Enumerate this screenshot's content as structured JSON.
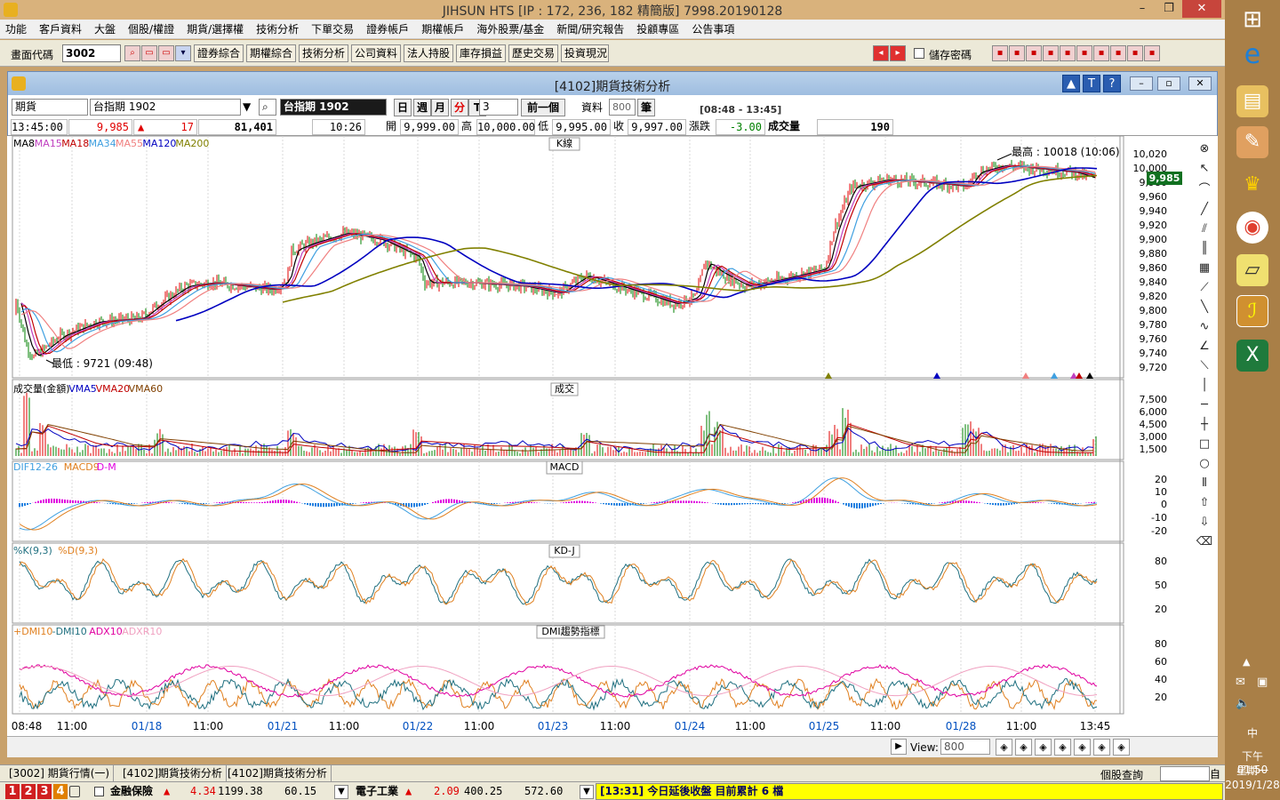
{
  "window": {
    "title": "JIHSUN HTS    [IP : 172, 236, 182 精簡版] 7998.20190128",
    "min": "–",
    "max": "❐",
    "close": "✕"
  },
  "menu": [
    "功能",
    "客戶資料",
    "大盤",
    "個股/權證",
    "期貨/選擇權",
    "技術分析",
    "下單交易",
    "證券帳戶",
    "期權帳戶",
    "海外股票/基金",
    "新聞/研究報告",
    "投顧專區",
    "公告事項"
  ],
  "toolbar": {
    "code_label": "畫面代碼",
    "code_value": "3002",
    "buttons": [
      "證券綜合",
      "期權綜合",
      "技術分析",
      "公司資料",
      "法人持股",
      "庫存損益",
      "歷史交易",
      "投資現況"
    ],
    "save_pwd_label": "儲存密碼"
  },
  "inner": {
    "title": "[4102]期貨技術分析",
    "type_value": "期貨",
    "contract_value": "台指期 1902",
    "contract_display": "台指期 1902",
    "periods": [
      "日",
      "週",
      "月",
      "分",
      "T"
    ],
    "period_active": "分",
    "minutes_value": "3",
    "prev_button": "前一個",
    "data_label": "資料",
    "data_value": "800",
    "bars_label": "筆",
    "session": "[08:48 - 13:45]"
  },
  "quote": {
    "time": "13:45:00",
    "price": "9,985",
    "change": "17",
    "volume_total": "81,401",
    "cursor_time": "10:26",
    "open_label": "開",
    "open": "9,999.00",
    "high_label": "高",
    "high": "10,000.00",
    "low_label": "低",
    "low": "9,995.00",
    "close_label": "收",
    "close": "9,997.00",
    "change_label": "漲跌",
    "change_val": "-3.00",
    "vol_label": "成交量",
    "vol": "190"
  },
  "panels": {
    "kline": {
      "title": "K線",
      "legend": [
        {
          "name": "MA8",
          "color": "#000000"
        },
        {
          "name": "MA15",
          "color": "#c040c0"
        },
        {
          "name": "MA18",
          "color": "#c00000"
        },
        {
          "name": "MA34",
          "color": "#40a0e0"
        },
        {
          "name": "MA55",
          "color": "#f08080"
        },
        {
          "name": "MA120",
          "color": "#0000c0"
        },
        {
          "name": "MA200",
          "color": "#808000"
        }
      ],
      "yticks": [
        "10,020",
        "10,000",
        "9,980",
        "9,960",
        "9,940",
        "9,920",
        "9,900",
        "9,880",
        "9,860",
        "9,840",
        "9,820",
        "9,800",
        "9,780",
        "9,760",
        "9,740",
        "9,720"
      ],
      "last_price_tag": "9,985",
      "high_note": "最高 : 10018 (10:06)",
      "low_note": "最低 : 9721 (09:48)"
    },
    "volume": {
      "title": "成交",
      "legend": [
        {
          "name": "成交量(金額)",
          "color": "#000000"
        },
        {
          "name": "VMA5",
          "color": "#0000c0"
        },
        {
          "name": "VMA20",
          "color": "#c00000"
        },
        {
          "name": "VMA60",
          "color": "#804000"
        }
      ],
      "yticks": [
        "7,500",
        "6,000",
        "4,500",
        "3,000",
        "1,500"
      ]
    },
    "macd": {
      "title": "MACD",
      "legend": [
        {
          "name": "DIF12-26",
          "color": "#40a0e0"
        },
        {
          "name": "MACD9",
          "color": "#e08020"
        },
        {
          "name": "D-M",
          "color": "#e000e0"
        }
      ],
      "yticks": [
        "20",
        "10",
        "0",
        "-10",
        "-20"
      ]
    },
    "kd": {
      "title": "KD-J",
      "legend": [
        {
          "name": "%K(9,3)",
          "color": "#207080"
        },
        {
          "name": "%D(9,3)",
          "color": "#e08020"
        }
      ],
      "yticks": [
        "80",
        "50",
        "20"
      ]
    },
    "dmi": {
      "title": "DMI趨勢指標",
      "legend": [
        {
          "name": "+DMI10",
          "color": "#e08020"
        },
        {
          "name": "-DMI10",
          "color": "#207080"
        },
        {
          "name": "ADX10",
          "color": "#e000a0"
        },
        {
          "name": "ADXR10",
          "color": "#f0a0c0"
        }
      ],
      "yticks": [
        "80",
        "60",
        "40",
        "20"
      ]
    }
  },
  "xaxis": [
    "08:48",
    "11:00",
    "01/18",
    "11:00",
    "01/21",
    "11:00",
    "01/22",
    "11:00",
    "01/23",
    "11:00",
    "01/24",
    "11:00",
    "01/25",
    "11:00",
    "01/28",
    "11:00",
    "13:45"
  ],
  "scroll": {
    "view_label": "View:",
    "view_value": "800"
  },
  "tabs": [
    "[3002] 期貨行情(一)",
    "[4102]期貨技術分析",
    "[4102]期貨技術分析"
  ],
  "search_label": "個股查詢",
  "search_btn": "自",
  "status": {
    "nums": [
      "1",
      "2",
      "3",
      "4"
    ],
    "items": [
      {
        "name": "金融保險",
        "chg": "4.34",
        "idx": "1199.38",
        "amt": "60.15"
      },
      {
        "name": "電子工業",
        "chg": "2.09",
        "idx": "400.25",
        "amt": "572.60"
      }
    ],
    "ticker": "[13:31] 今日延後收盤 目前累計 6 檔"
  },
  "tray": {
    "lang": "中",
    "time": "下午 01:50",
    "day": "星期一",
    "date": "2019/1/28"
  }
}
